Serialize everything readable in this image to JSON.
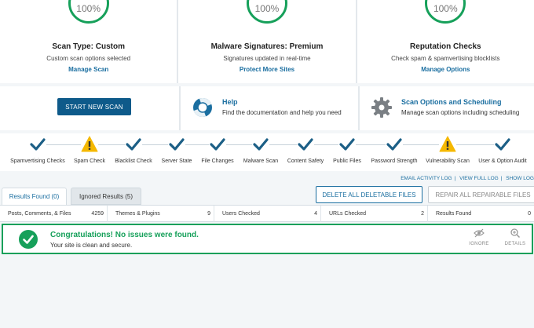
{
  "cards": [
    {
      "percent": "100%",
      "title": "Scan Type: Custom",
      "subtitle": "Custom scan options selected",
      "link": "Manage Scan"
    },
    {
      "percent": "100%",
      "title": "Malware Signatures: Premium",
      "subtitle": "Signatures updated in real-time",
      "link": "Protect More Sites"
    },
    {
      "percent": "100%",
      "title": "Reputation Checks",
      "subtitle": "Check spam & spamvertising blocklists",
      "link": "Manage Options"
    }
  ],
  "actions": {
    "start_label": "START NEW SCAN",
    "help_title": "Help",
    "help_sub": "Find the documentation and help you need",
    "options_title": "Scan Options and Scheduling",
    "options_sub": "Manage scan options including scheduling"
  },
  "stages": [
    {
      "label": "Spamvertising Checks",
      "status": "check"
    },
    {
      "label": "Spam Check",
      "status": "warning"
    },
    {
      "label": "Blacklist Check",
      "status": "check"
    },
    {
      "label": "Server State",
      "status": "check"
    },
    {
      "label": "File Changes",
      "status": "check"
    },
    {
      "label": "Malware Scan",
      "status": "check"
    },
    {
      "label": "Content Safety",
      "status": "check"
    },
    {
      "label": "Public Files",
      "status": "check"
    },
    {
      "label": "Password Strength",
      "status": "check"
    },
    {
      "label": "Vulnerability Scan",
      "status": "warning"
    },
    {
      "label": "User & Option Audit",
      "status": "check"
    }
  ],
  "logs": {
    "email": "EMAIL ACTIVITY LOG",
    "full": "VIEW FULL LOG",
    "show": "SHOW LOG"
  },
  "tabs": {
    "found": "Results Found (0)",
    "ignored": "Ignored Results (5)"
  },
  "buttons": {
    "delete": "DELETE ALL DELETABLE FILES",
    "repair": "REPAIR ALL REPAIRABLE FILES"
  },
  "stats": [
    {
      "label": "Posts, Comments, & Files",
      "value": "4259"
    },
    {
      "label": "Themes & Plugins",
      "value": "9"
    },
    {
      "label": "Users Checked",
      "value": "4"
    },
    {
      "label": "URLs Checked",
      "value": "2"
    },
    {
      "label": "Results Found",
      "value": "0"
    }
  ],
  "result": {
    "title": "Congratulations! No issues were found.",
    "subtitle": "Your site is clean and secure.",
    "ignore": "IGNORE",
    "details": "DETAILS"
  },
  "colors": {
    "accent": "#1a6ea0",
    "button": "#0e5a8a",
    "success": "#16a05a",
    "warning": "#f5b800",
    "check": "#1c5f86"
  },
  "icons": {
    "help": "lifebuoy-icon",
    "options": "gear-icon",
    "ok": "check-circle-icon",
    "ignore": "eye-slash-icon",
    "details": "magnifier-icon"
  }
}
